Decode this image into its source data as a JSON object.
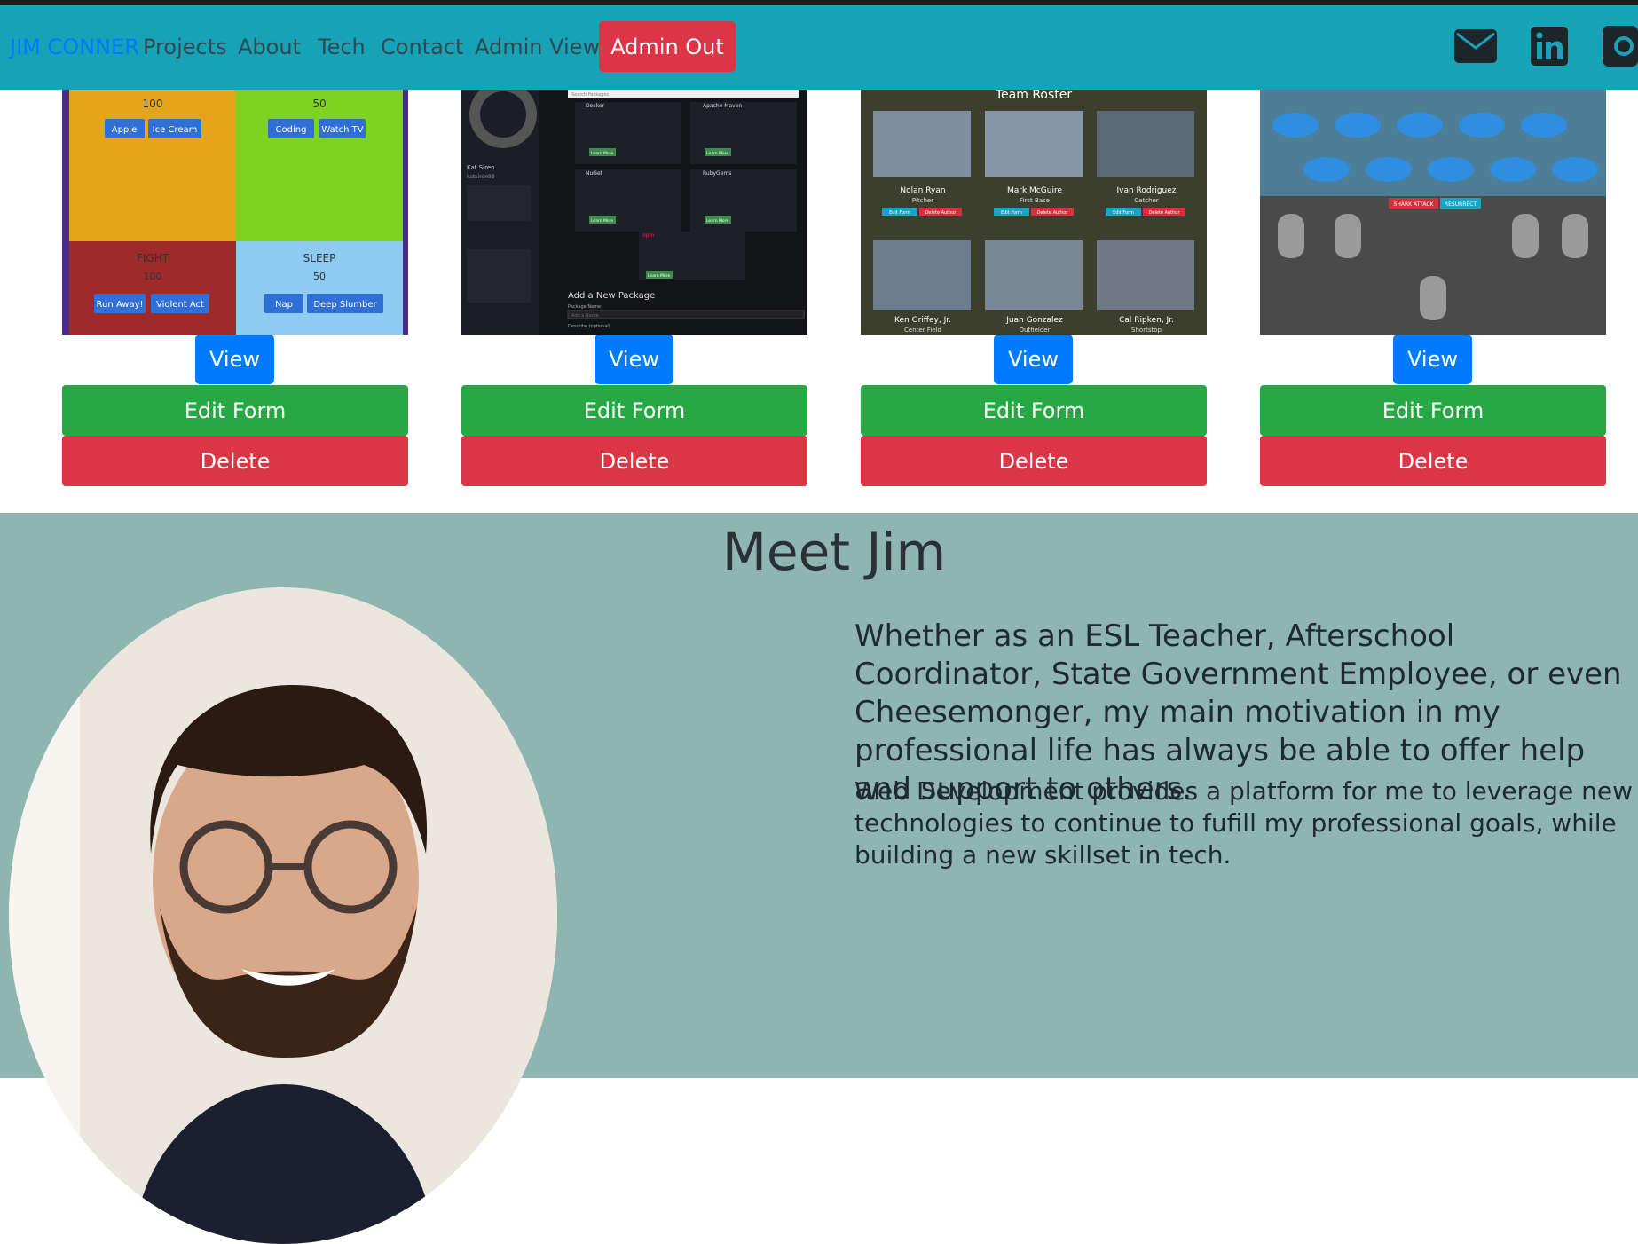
{
  "nav": {
    "brand": "JIM CONNER",
    "links": [
      "Projects",
      "About",
      "Tech",
      "Contact",
      "Admin View"
    ],
    "admin_button": "Admin Out",
    "social_icons": [
      "mail-icon",
      "linkedin-icon",
      "github-icon"
    ]
  },
  "projects": [
    {
      "preview": {
        "cells": [
          {
            "value": "100",
            "buttons": [
              "Apple",
              "Ice Cream"
            ]
          },
          {
            "value": "50",
            "buttons": [
              "Coding",
              "Watch TV"
            ]
          },
          {
            "label": "FIGHT",
            "value": "100",
            "buttons": [
              "Run Away!",
              "Violent Act"
            ]
          },
          {
            "label": "SLEEP",
            "value": "50",
            "buttons": [
              "Nap",
              "Deep Slumber"
            ]
          }
        ]
      },
      "view": "View",
      "edit": "Edit Form",
      "delete": "Delete"
    },
    {
      "preview": {
        "search_placeholder": "Search Packages",
        "user_name": "Kat Siren",
        "user_handle": "katsiren93",
        "packages": [
          {
            "name": "Docker",
            "learn": "Learn More"
          },
          {
            "name": "Apache Maven",
            "learn": "Learn More"
          },
          {
            "name": "NuGet",
            "learn": "Learn More"
          },
          {
            "name": "RubyGems",
            "learn": "Learn More"
          },
          {
            "name": "npm",
            "learn": "Learn More"
          }
        ],
        "form_title": "Add a New Package",
        "form_label1": "Package Name",
        "form_placeholder": "Add a Name",
        "form_label2": "Describe (optional)"
      },
      "view": "View",
      "edit": "Edit Form",
      "delete": "Delete"
    },
    {
      "preview": {
        "title": "Team Roster",
        "players": [
          {
            "name": "Nolan Ryan",
            "position": "Pitcher"
          },
          {
            "name": "Mark McGuire",
            "position": "First Base"
          },
          {
            "name": "Ivan Rodriguez",
            "position": "Catcher"
          },
          {
            "name": "Ken Griffey, Jr.",
            "position": "Center Field"
          },
          {
            "name": "Juan Gonzalez",
            "position": "Outfielder"
          },
          {
            "name": "Cal Ripken, Jr.",
            "position": "Shortstop"
          }
        ],
        "edit_label": "Edit Form",
        "delete_label": "Delete Author"
      },
      "view": "View",
      "edit": "Edit Form",
      "delete": "Delete"
    },
    {
      "preview": {
        "buttons": [
          "SHARK ATTACK",
          "RESURRECT"
        ]
      },
      "view": "View",
      "edit": "Edit Form",
      "delete": "Delete"
    }
  ],
  "about": {
    "title": "Meet Jim",
    "para1": "Whether as an ESL Teacher, Afterschool Coordinator, State Government Employee, or even Cheesemonger, my main motivation in my professional life has always be able to offer help and support to others.",
    "para2": "Web Development provides a platform for me to leverage new technologies to continue to fufill my professional goals, while building a new skillset in tech."
  },
  "colors": {
    "navbar": "#17a2b8",
    "about_bg": "#8fb5b1",
    "primary": "#007bff",
    "success": "#28a745",
    "danger": "#dc3545"
  }
}
